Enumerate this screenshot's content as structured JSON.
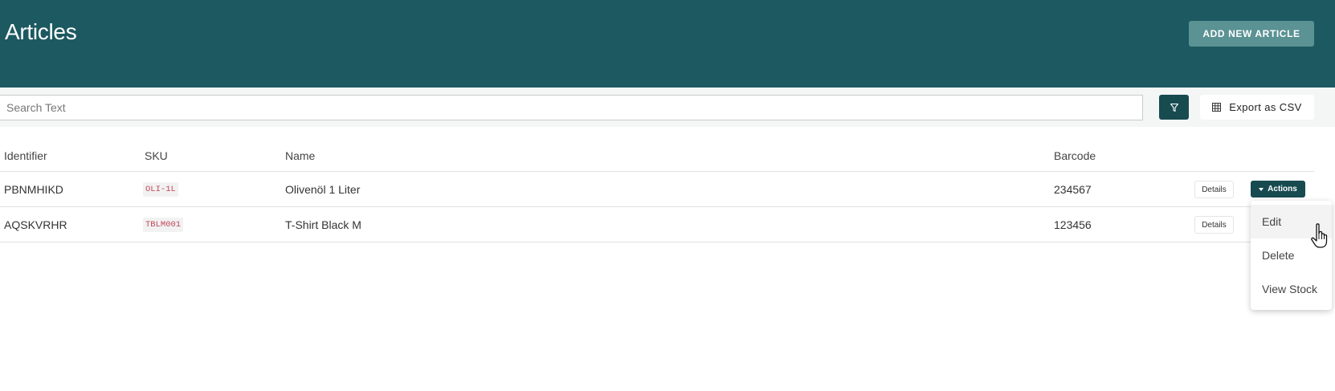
{
  "header": {
    "title": "Articles",
    "add_button": "ADD NEW ARTICLE"
  },
  "toolbar": {
    "search_placeholder": "Search Text",
    "filter_icon": "filter-icon",
    "export_label": "Export as CSV",
    "export_icon": "grid-icon"
  },
  "table": {
    "columns": [
      "Identifier",
      "SKU",
      "Name",
      "Barcode"
    ],
    "rows": [
      {
        "identifier": "PBNMHIKD",
        "sku": "OLI-1L",
        "name": "Olivenöl 1 Liter",
        "barcode": "234567",
        "details": "Details",
        "actions": "Actions"
      },
      {
        "identifier": "AQSKVRHR",
        "sku": "TBLM001",
        "name": "T-Shirt Black M",
        "barcode": "123456",
        "details": "Details"
      }
    ]
  },
  "actions_menu": {
    "items": [
      "Edit",
      "Delete",
      "View Stock"
    ],
    "hovered": "Edit"
  },
  "colors": {
    "header_bg": "#1c5961",
    "primary_button": "#174b50",
    "add_button_bg": "#5b9294",
    "sku_text": "#c0485a"
  }
}
